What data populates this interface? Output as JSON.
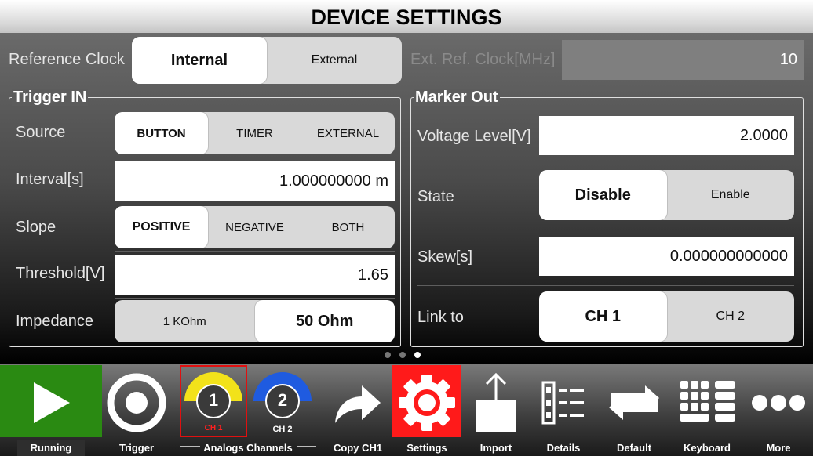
{
  "header": {
    "title": "DEVICE SETTINGS"
  },
  "reference_clock": {
    "label": "Reference Clock",
    "options": [
      "Internal",
      "External"
    ],
    "selected": "Internal",
    "ext_label": "Ext. Ref. Clock[MHz]",
    "ext_value": "10"
  },
  "trigger_in": {
    "title": "Trigger IN",
    "source_label": "Source",
    "source_options": [
      "BUTTON",
      "TIMER",
      "EXTERNAL"
    ],
    "source_selected": "BUTTON",
    "interval_label": "Interval[s]",
    "interval_value": "1.000000000 m",
    "slope_label": "Slope",
    "slope_options": [
      "POSITIVE",
      "NEGATIVE",
      "BOTH"
    ],
    "slope_selected": "POSITIVE",
    "threshold_label": "Threshold[V]",
    "threshold_value": "1.65",
    "impedance_label": "Impedance",
    "impedance_options": [
      "1 KOhm",
      "50 Ohm"
    ],
    "impedance_selected": "50 Ohm"
  },
  "marker_out": {
    "title": "Marker Out",
    "voltage_label": "Voltage Level[V]",
    "voltage_value": "2.0000",
    "state_label": "State",
    "state_options": [
      "Disable",
      "Enable"
    ],
    "state_selected": "Disable",
    "skew_label": "Skew[s]",
    "skew_value": "0.000000000000",
    "link_label": "Link to",
    "link_options": [
      "CH 1",
      "CH 2"
    ],
    "link_selected": "CH 1"
  },
  "page_indicator": {
    "count": 3,
    "active": 3
  },
  "toolbar": {
    "running": "Running",
    "trigger": "Trigger",
    "analogs": "Analogs Channels",
    "ch1_num": "1",
    "ch1_label": "CH 1",
    "ch2_num": "2",
    "ch2_label": "CH 2",
    "copy": "Copy CH1",
    "settings": "Settings",
    "import": "Import",
    "details": "Details",
    "default": "Default",
    "keyboard": "Keyboard",
    "more": "More"
  },
  "colors": {
    "running_bg": "#2a8a12",
    "settings_bg": "#ff1a1a",
    "ch1_color": "#f2e21a",
    "ch2_color": "#1f5be0",
    "ch1_label_color": "#ff2020"
  }
}
